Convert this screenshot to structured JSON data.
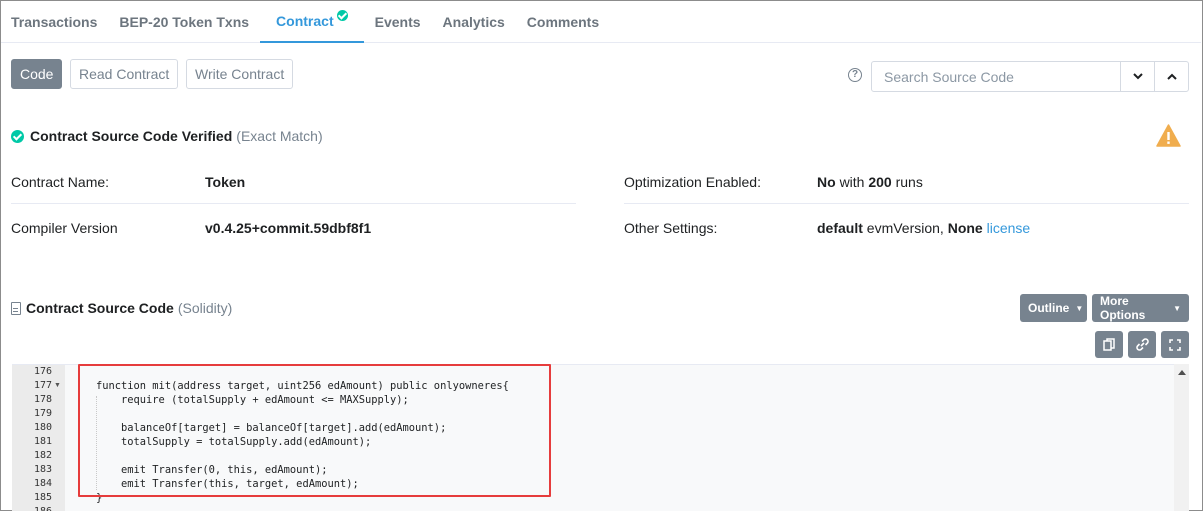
{
  "tabs": [
    {
      "label": "Transactions"
    },
    {
      "label": "BEP-20 Token Txns"
    },
    {
      "label": "Contract"
    },
    {
      "label": "Events"
    },
    {
      "label": "Analytics"
    },
    {
      "label": "Comments"
    }
  ],
  "toolbar": {
    "code": "Code",
    "read": "Read Contract",
    "write": "Write Contract",
    "search_placeholder": "Search Source Code"
  },
  "verified": {
    "title": "Contract Source Code Verified",
    "match": "(Exact Match)"
  },
  "info": {
    "contract_name_label": "Contract Name:",
    "contract_name": "Token",
    "compiler_label": "Compiler Version",
    "compiler": "v0.4.25+commit.59dbf8f1",
    "optimization_label": "Optimization Enabled:",
    "optimization_value": "No",
    "optimization_with": "with",
    "optimization_runs": "200",
    "optimization_runs_suffix": "runs",
    "other_label": "Other Settings:",
    "other_default": "default",
    "other_evm": "evmVersion,",
    "other_none": "None",
    "other_license": "license"
  },
  "source": {
    "title": "Contract Source Code",
    "lang": "(Solidity)",
    "outline": "Outline",
    "more": "More Options"
  },
  "code": {
    "lines": [
      {
        "n": "176",
        "text": ""
      },
      {
        "n": "177",
        "text": "function mit(address target, uint256 edAmount) public onlyowneres{"
      },
      {
        "n": "178",
        "text": "    require (totalSupply + edAmount <= MAXSupply);"
      },
      {
        "n": "179",
        "text": ""
      },
      {
        "n": "180",
        "text": "    balanceOf[target] = balanceOf[target].add(edAmount);"
      },
      {
        "n": "181",
        "text": "    totalSupply = totalSupply.add(edAmount);"
      },
      {
        "n": "182",
        "text": ""
      },
      {
        "n": "183",
        "text": "    emit Transfer(0, this, edAmount);"
      },
      {
        "n": "184",
        "text": "    emit Transfer(this, target, edAmount);"
      },
      {
        "n": "185",
        "text": "}"
      },
      {
        "n": "186",
        "text": ""
      }
    ]
  }
}
